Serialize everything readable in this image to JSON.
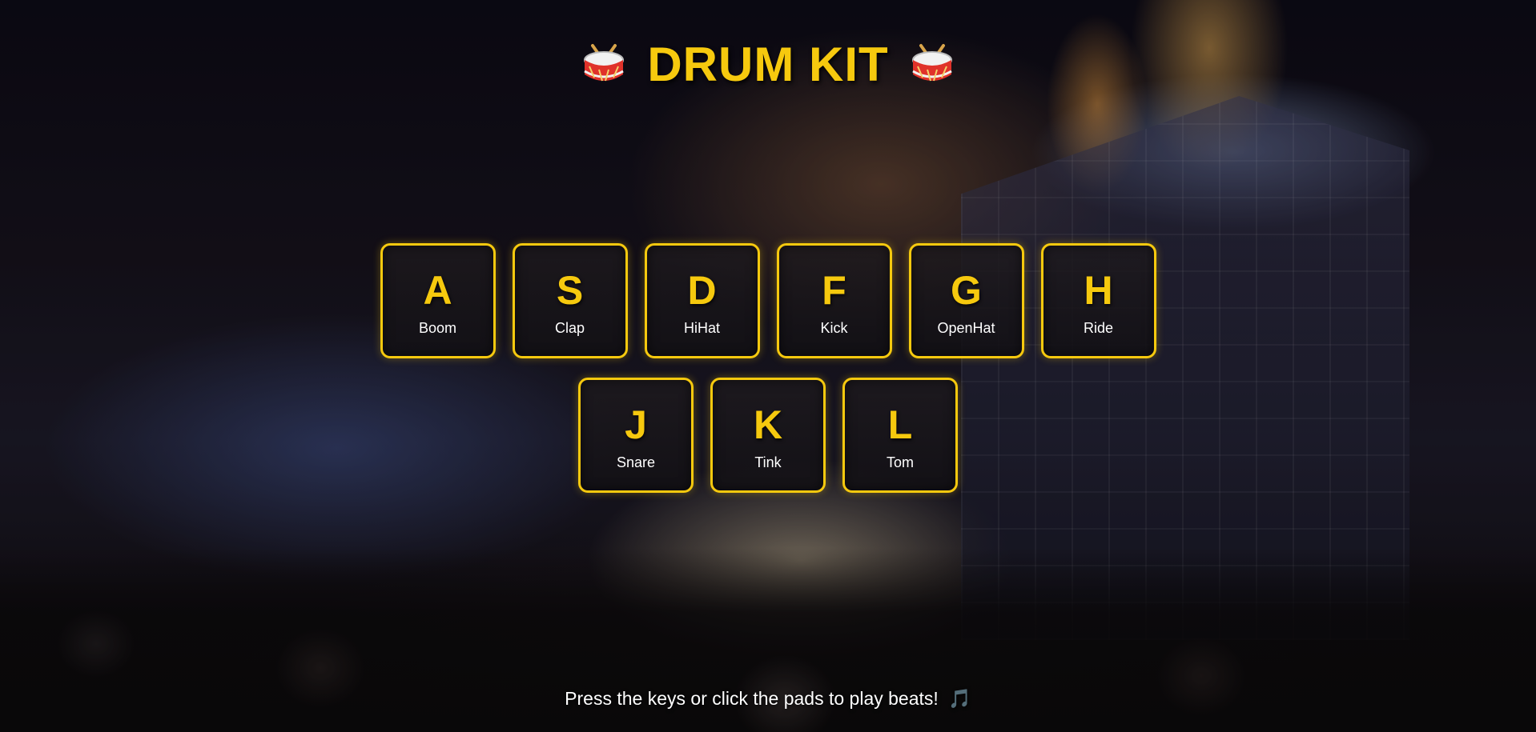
{
  "header": {
    "title": "DRUM KIT",
    "left_icon": "drum-icon",
    "right_icon": "drum-icon"
  },
  "pads": [
    {
      "key": "A",
      "sound": "Boom"
    },
    {
      "key": "S",
      "sound": "Clap"
    },
    {
      "key": "D",
      "sound": "HiHat"
    },
    {
      "key": "F",
      "sound": "Kick"
    },
    {
      "key": "G",
      "sound": "OpenHat"
    },
    {
      "key": "H",
      "sound": "Ride"
    },
    {
      "key": "J",
      "sound": "Snare"
    },
    {
      "key": "K",
      "sound": "Tink"
    },
    {
      "key": "L",
      "sound": "Tom"
    }
  ],
  "footer": {
    "hint": "Press the keys or click the pads to play beats!",
    "hint_icon": "music-note-icon",
    "hint_icon_glyph": "🎵"
  },
  "colors": {
    "accent": "#f6c90e",
    "pad_label": "#ffffff",
    "background": "#0b0a14"
  }
}
